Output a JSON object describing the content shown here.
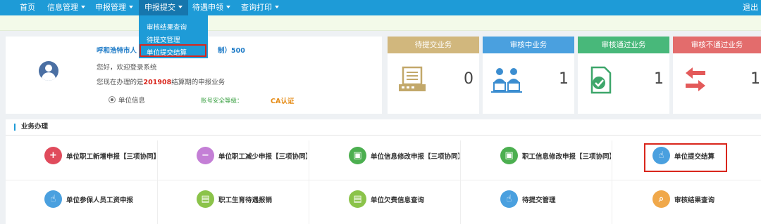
{
  "nav": {
    "items": [
      {
        "label": "首页"
      },
      {
        "label": "信息管理"
      },
      {
        "label": "申报管理"
      },
      {
        "label": "申报提交"
      },
      {
        "label": "待遇申领"
      },
      {
        "label": "查询打印"
      }
    ],
    "logout": "退出"
  },
  "dropdown": {
    "items": [
      {
        "label": "审核结果查询"
      },
      {
        "label": "待提交管理"
      },
      {
        "label": "单位提交结算"
      }
    ]
  },
  "user": {
    "org_name": "呼和浩特市人",
    "org_suffix": "制）500",
    "greeting": "您好，欢迎登录系统",
    "period_prefix": "您现在办理的是",
    "period_value": "201908",
    "period_suffix": "结算期的申报业务",
    "unit_info": "单位信息",
    "security_level": "账号安全等级：",
    "ca": "CA认证"
  },
  "stats": [
    {
      "label": "待提交业务",
      "value": "0",
      "color": "#d1b77d",
      "icon": "printer-icon"
    },
    {
      "label": "审核中业务",
      "value": "1",
      "color": "#4aa0df",
      "icon": "people-icon"
    },
    {
      "label": "审核通过业务",
      "value": "1",
      "color": "#48b87a",
      "icon": "approved-document-icon"
    },
    {
      "label": "审核不通过业务",
      "value": "1",
      "color": "#e36c6c",
      "icon": "rejected-arrows-icon"
    }
  ],
  "business": {
    "title": "业务办理",
    "items": [
      {
        "label": "单位职工新增申报【三项协同】",
        "color": "#e04b5c",
        "icon": "add-user-icon",
        "glyph": "+"
      },
      {
        "label": "单位职工减少申报【三项协同】",
        "color": "#c47fd6",
        "icon": "remove-user-icon",
        "glyph": "−"
      },
      {
        "label": "单位信息修改申报【三项协同】",
        "color": "#4caf50",
        "icon": "id-card-icon",
        "glyph": "▣"
      },
      {
        "label": "职工信息修改申报【三项协同】",
        "color": "#4caf50",
        "icon": "id-card-icon",
        "glyph": "▣"
      },
      {
        "label": "单位提交结算",
        "color": "#4aa0df",
        "icon": "hand-pointer-icon",
        "glyph": "☝"
      },
      {
        "label": "单位参保人员工资申报",
        "color": "#4aa0df",
        "icon": "hand-pointer-icon",
        "glyph": "☝"
      },
      {
        "label": "职工生育待遇报销",
        "color": "#8bc34a",
        "icon": "document-icon",
        "glyph": "▤"
      },
      {
        "label": "单位欠费信息查询",
        "color": "#8bc34a",
        "icon": "document-icon",
        "glyph": "▤"
      },
      {
        "label": "待提交管理",
        "color": "#4aa0df",
        "icon": "hand-pointer-icon",
        "glyph": "☝"
      },
      {
        "label": "审核结果查询",
        "color": "#f0a84a",
        "icon": "search-icon",
        "glyph": "⌕"
      }
    ]
  }
}
